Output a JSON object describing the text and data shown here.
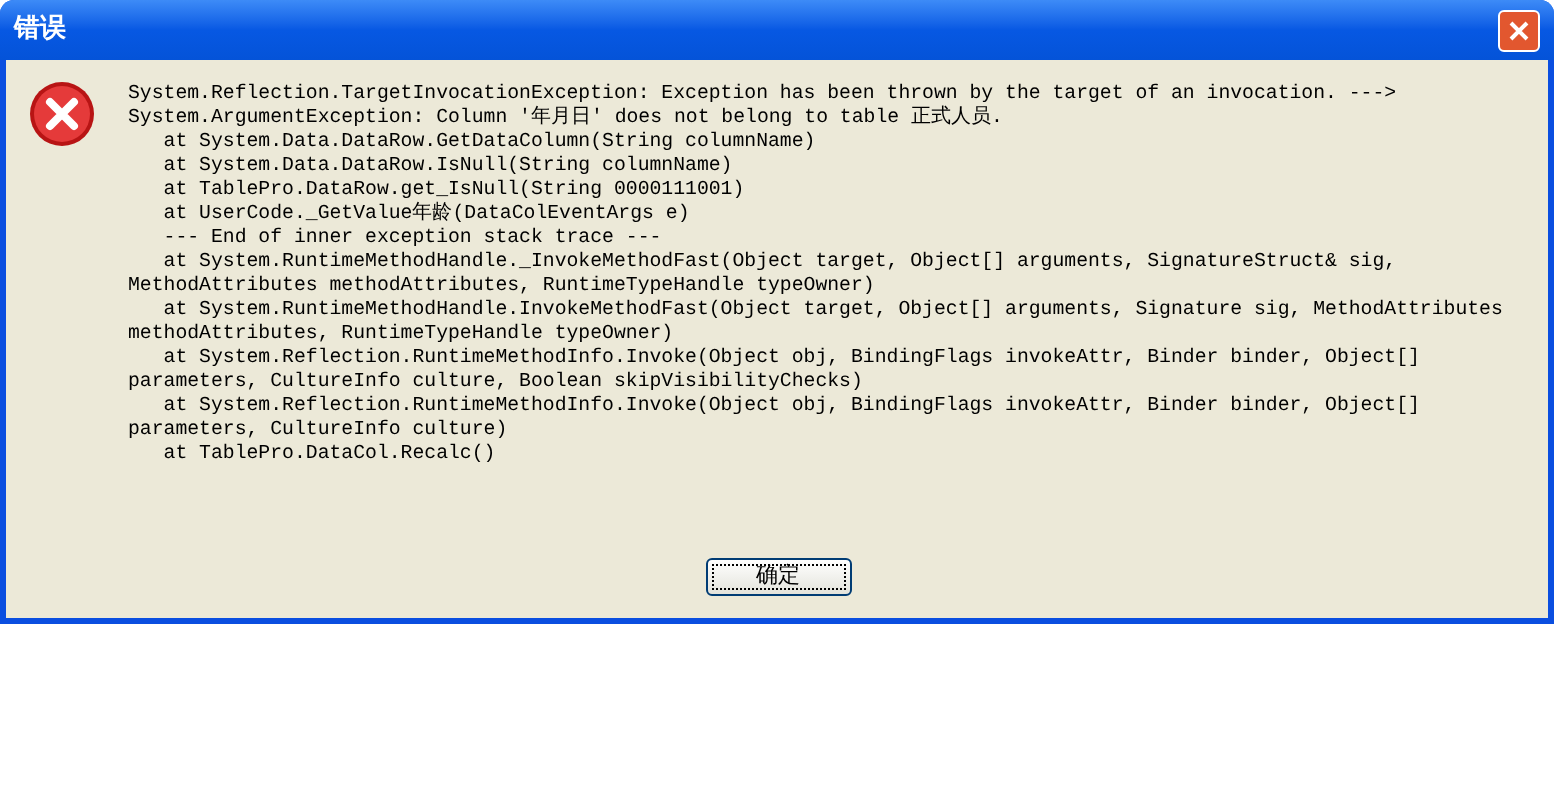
{
  "window": {
    "title": "错误"
  },
  "message_lines": [
    "System.Reflection.TargetInvocationException: Exception has been thrown by the target of an invocation. --->",
    "System.ArgumentException: Column '年月日' does not belong to table 正式人员.",
    "   at System.Data.DataRow.GetDataColumn(String columnName)",
    "   at System.Data.DataRow.IsNull(String columnName)",
    "   at TablePro.DataRow.get_IsNull(String 0000111001)",
    "   at UserCode._GetValue年龄(DataColEventArgs e)",
    "   --- End of inner exception stack trace ---",
    "   at System.RuntimeMethodHandle._InvokeMethodFast(Object target, Object[] arguments, SignatureStruct& sig,",
    "MethodAttributes methodAttributes, RuntimeTypeHandle typeOwner)",
    "   at System.RuntimeMethodHandle.InvokeMethodFast(Object target, Object[] arguments, Signature sig, MethodAttributes",
    "methodAttributes, RuntimeTypeHandle typeOwner)",
    "   at System.Reflection.RuntimeMethodInfo.Invoke(Object obj, BindingFlags invokeAttr, Binder binder, Object[]",
    "parameters, CultureInfo culture, Boolean skipVisibilityChecks)",
    "   at System.Reflection.RuntimeMethodInfo.Invoke(Object obj, BindingFlags invokeAttr, Binder binder, Object[]",
    "parameters, CultureInfo culture)",
    "   at TablePro.DataCol.Recalc()"
  ],
  "buttons": [
    "确定"
  ]
}
